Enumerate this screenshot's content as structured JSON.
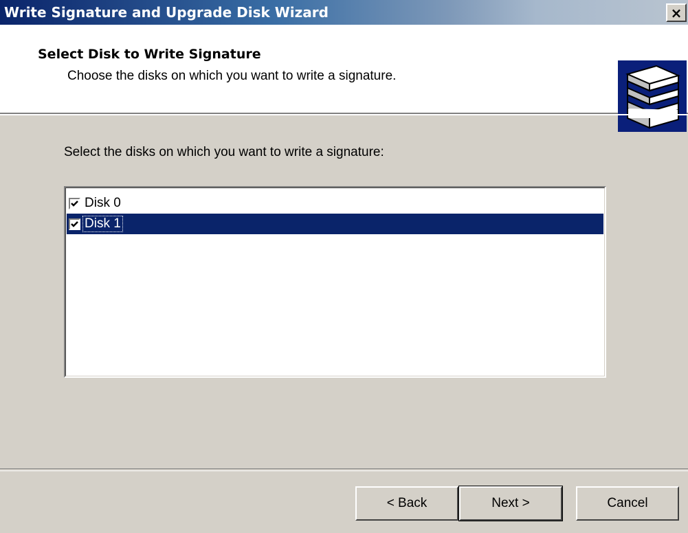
{
  "window": {
    "title": "Write Signature and Upgrade Disk Wizard",
    "close_glyph": "×"
  },
  "header": {
    "title": "Select Disk to Write Signature",
    "subtitle": "Choose the disks on which you want to write a signature.",
    "icon": "disk-stack-icon"
  },
  "content": {
    "label": "Select the disks on which you want to write a signature:",
    "disks": [
      {
        "label": "Disk 0",
        "checked": true,
        "selected": false
      },
      {
        "label": "Disk 1",
        "checked": true,
        "selected": true
      }
    ]
  },
  "buttons": {
    "back": "< Back",
    "next": "Next >",
    "cancel": "Cancel"
  },
  "colors": {
    "selection": "#0a246a",
    "face": "#d4d0c8"
  }
}
